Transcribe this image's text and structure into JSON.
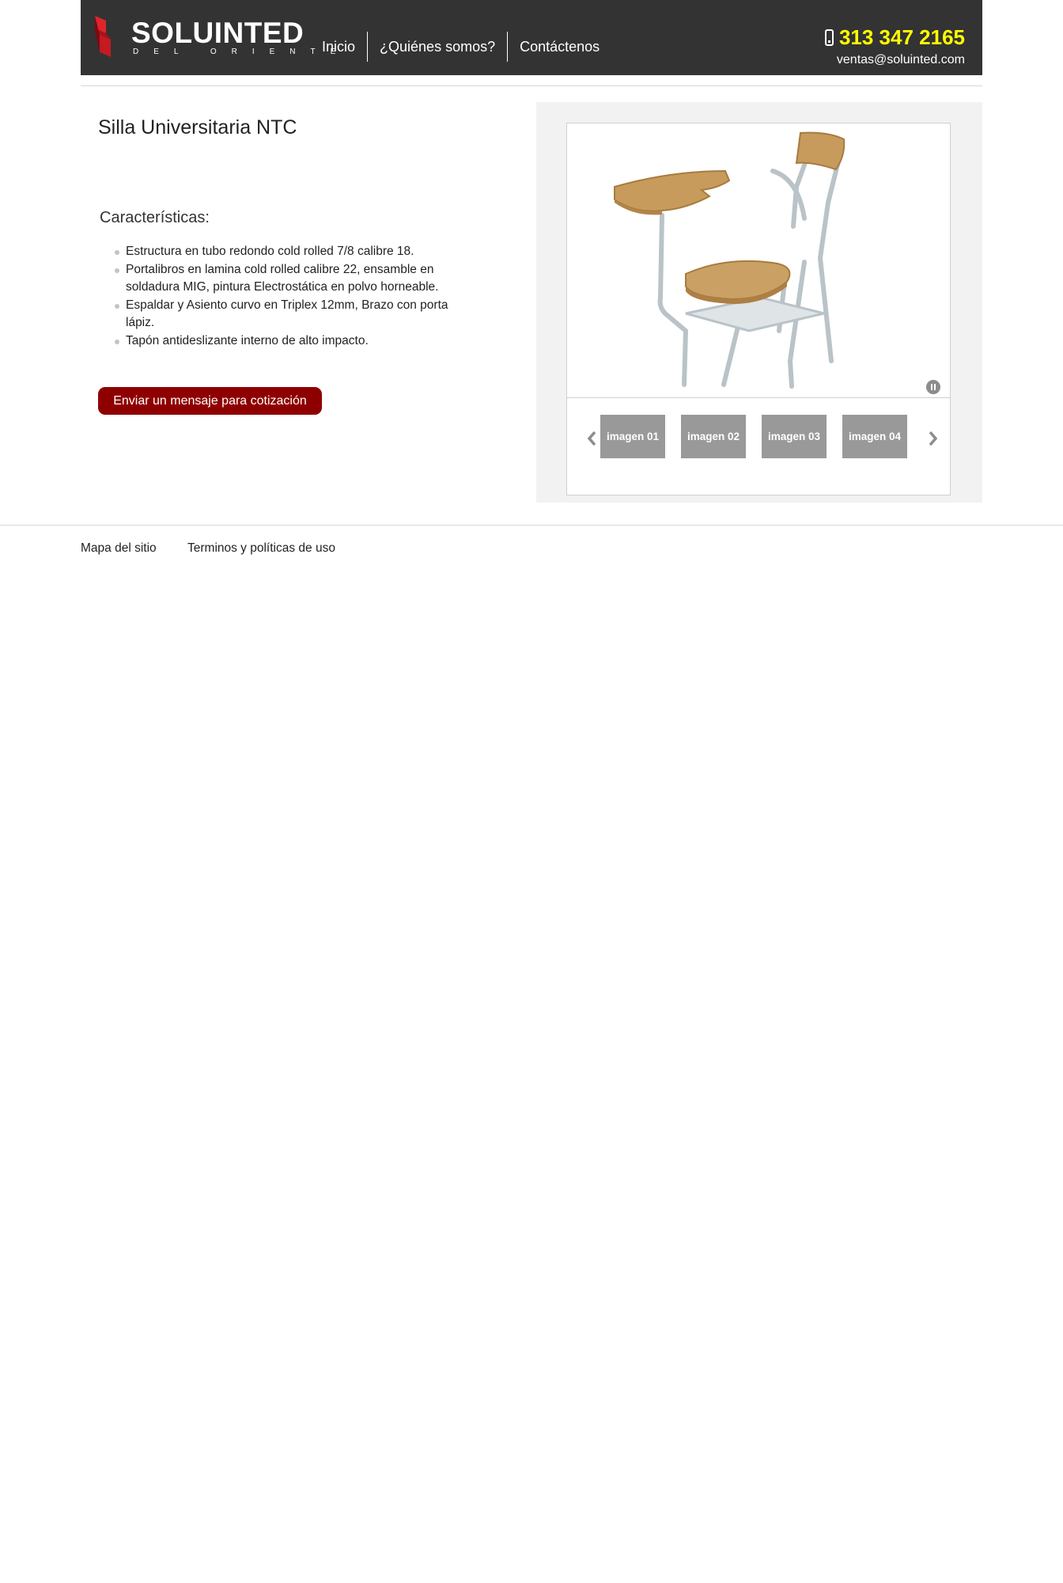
{
  "header": {
    "logo_name": "SOLUINTED",
    "logo_subtitle": "DEL ORIENTE",
    "nav": [
      "Inicio",
      "¿Quiénes somos?",
      "Contáctenos"
    ],
    "phone": "313 347 2165",
    "email": "ventas@soluinted.com"
  },
  "product": {
    "title": "Silla Universitaria NTC",
    "features_heading": "Características:",
    "features": [
      "Estructura en tubo redondo cold rolled 7/8 calibre 18.",
      "Portalibros en lamina cold rolled calibre 22, ensamble en soldadura MIG, pintura Electrostática en polvo horneable.",
      "Espaldar y Asiento curvo en Triplex 12mm, Brazo con porta lápiz.",
      "Tapón antideslizante interno  de alto impacto."
    ],
    "quote_button": "Enviar un mensaje para cotización"
  },
  "gallery": {
    "thumbnails": [
      "imagen 01",
      "imagen 02",
      "imagen 03",
      "imagen 04"
    ]
  },
  "footer": {
    "links": [
      "Mapa del sitio",
      "Terminos y políticas de uso"
    ]
  },
  "colors": {
    "header_bg": "#333333",
    "phone": "#ffff00",
    "accent_button": "#8e0000",
    "thumbnail_bg": "#999999",
    "gallery_bg": "#f2f2f2"
  },
  "icons": [
    "logo-mark-icon",
    "phone-icon",
    "pause-icon",
    "chevron-left-icon",
    "chevron-right-icon"
  ]
}
